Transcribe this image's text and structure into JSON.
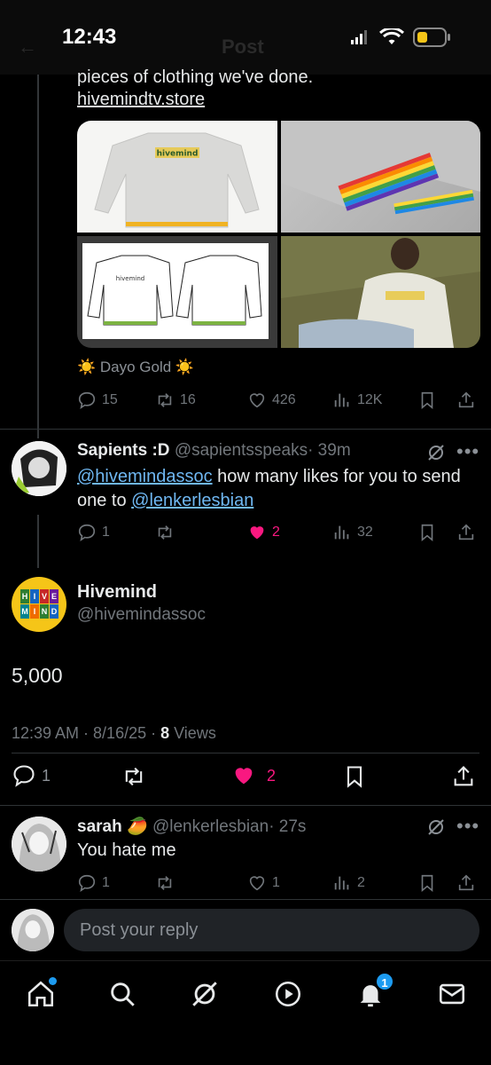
{
  "status": {
    "time": "12:43"
  },
  "header": {
    "title": "Post"
  },
  "first_post": {
    "text_partial": "pieces of clothing we've done.",
    "link": "hivemindtv.store",
    "media_alts": [
      "hivemind sweatshirt front",
      "rainbow ribbed cuff",
      "sweatshirt design sketches",
      "model wearing sweatshirt"
    ],
    "media_print": "hivemind",
    "quote_label": "☀️ Dayo Gold ☀️",
    "stats": {
      "replies": "15",
      "reposts": "16",
      "likes": "426",
      "views": "12K"
    }
  },
  "reply1": {
    "name": "Sapients :D",
    "handle": "@sapientsspeaks",
    "time": "· 39m",
    "mention1": "@hivemindassoc",
    "text_mid": " how many likes for you to send one to ",
    "mention2": "@lenkerlesbian",
    "stats": {
      "replies": "1",
      "reposts": "",
      "likes": "2",
      "views": "32"
    }
  },
  "main_post": {
    "name": "Hivemind",
    "handle": "@hivemindassoc",
    "avatar_letters": [
      "H",
      "I",
      "V",
      "E",
      "M",
      "I",
      "N",
      "D"
    ],
    "text": "5,000",
    "timestamp": "12:39 AM · 8/16/25 · ",
    "views_count": "8",
    "views_label": " Views",
    "stats": {
      "replies": "1",
      "likes": "2"
    }
  },
  "reply2": {
    "name": "sarah",
    "emoji": "🥭",
    "handle": "@lenkerlesbian",
    "time": "· 27s",
    "text": "You hate me",
    "stats": {
      "replies": "1",
      "likes": "1",
      "views": "2"
    }
  },
  "compose": {
    "placeholder": "Post your reply"
  },
  "tabbar": {
    "notifications_count": "1"
  },
  "colors": {
    "like_pink": "#f91880",
    "link_blue": "#6fb7f2",
    "accent": "#1d9bf0"
  }
}
